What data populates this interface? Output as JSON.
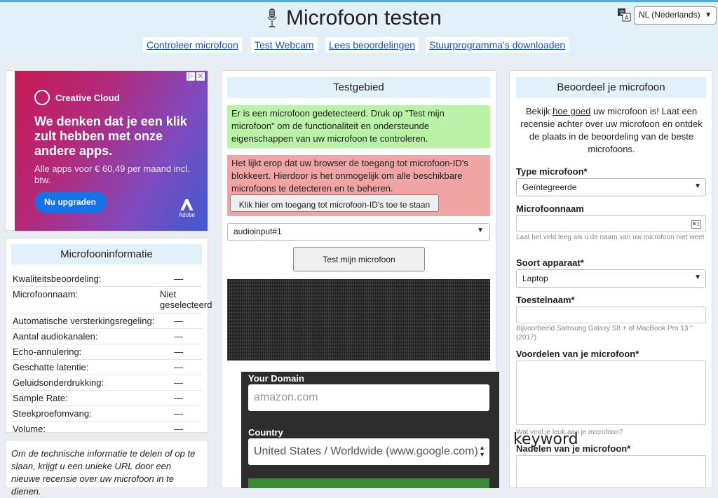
{
  "header": {
    "title": "Microfoon testen",
    "nav": [
      "Controleer microfoon",
      "Test Webcam",
      "Lees beoordelingen",
      "Stuurprogramma's downloaden"
    ],
    "language": "NL (Nederlands)"
  },
  "ad": {
    "brand": "Creative Cloud",
    "headline": "We denken dat je een klik zult hebben met onze andere apps.",
    "sub": "Alle apps voor € 60,49 per maand incl. btw.",
    "cta": "Nu upgraden",
    "logo_text": "Adobe",
    "close": "✕",
    "adchoices": "▷"
  },
  "info": {
    "title": "Microfooninformatie",
    "rows": [
      {
        "k": "Kwaliteitsbeoordeling:",
        "v": "—"
      },
      {
        "k": "Microfoonnaam:",
        "v": "Niet geselecteerd"
      },
      {
        "k": "Automatische versterkingsregeling:",
        "v": "—"
      },
      {
        "k": "Aantal audiokanalen:",
        "v": "—"
      },
      {
        "k": "Echo-annulering:",
        "v": "—"
      },
      {
        "k": "Geschatte latentie:",
        "v": "—"
      },
      {
        "k": "Geluidsonderdrukking:",
        "v": "—"
      },
      {
        "k": "Sample Rate:",
        "v": "—"
      },
      {
        "k": "Steekproefomvang:",
        "v": "—"
      },
      {
        "k": "Volume:",
        "v": "—"
      }
    ],
    "note": "Om de technische informatie te delen of op te slaan, krijgt u een unieke URL door een nieuwe recensie over uw microfoon in te dienen."
  },
  "test": {
    "title": "Testgebied",
    "green_msg": "Er is een microfoon gedetecteerd. Druk op \"Test mijn microfoon\" om de functionaliteit en ondersteunde eigenschappen van uw microfoon te controleren.",
    "red_msg": "Het lijkt erop dat uw browser de toegang tot microfoon-ID's blokkeert. Hierdoor is het onmogelijk om alle beschikbare microfoons te detecteren en te beheren.",
    "allow_btn": "Klik hier om toegang tot microfoon-ID's toe te staan",
    "device": "audioinput#1",
    "test_btn": "Test mijn microfoon"
  },
  "overlay": {
    "domain_label": "Your Domain",
    "domain_placeholder": "amazon.com",
    "country_label": "Country",
    "country_value": "United States / Worldwide (www.google.com)"
  },
  "review": {
    "title": "Beoordeel je microfoon",
    "intro_pre": "Bekijk ",
    "intro_link": "hoe goed",
    "intro_post": " uw microfoon is! Laat een recensie achter over uw microfoon en ontdek de plaats in de beoordeling van de beste microfoons.",
    "type_label": "Type microfoon*",
    "type_value": "Geïntegreerde",
    "name_label": "Microfoonnaam",
    "name_hint": "Laat het veld leeg als u de naam van uw microfoon niet weet",
    "device_label": "Soort apparaat*",
    "device_value": "Laptop",
    "model_label": "Toestelnaam*",
    "model_hint": "Bijvoorbeeld Samsung Galaxy S8 + of MacBook Pro 13 \" (2017)",
    "pros_label": "Voordelen van je microfoon*",
    "pros_hint": "Wat vind je leuk aan je microfoon?",
    "cons_label": "Nadelen van je microfoon*",
    "keyword": "keyword"
  }
}
